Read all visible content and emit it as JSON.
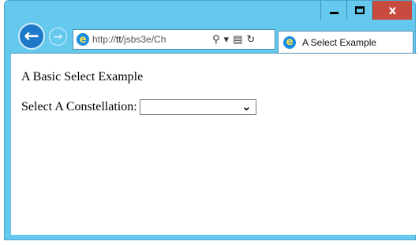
{
  "window": {
    "minimize_label": "Minimize",
    "maximize_label": "Maximize",
    "close_label": "x"
  },
  "navigation": {
    "back_icon": "back-arrow-icon",
    "forward_icon": "forward-arrow-icon",
    "url_prefix": "http://",
    "url_host": "tt",
    "url_path": "/jsbs3e/Ch",
    "search_icon": "search-icon",
    "dropdown_icon": "chevron-down-icon",
    "compat_icon": "compatibility-view-icon",
    "refresh_icon": "refresh-icon"
  },
  "tab": {
    "title": "A Select Example",
    "icon": "ie-icon"
  },
  "page": {
    "heading": "A Basic Select Example",
    "select_label": "Select A Constellation:",
    "select_value": ""
  },
  "colors": {
    "frame": "#64c9ec",
    "close_button": "#c74b3f",
    "back_button": "#1f79c9"
  }
}
